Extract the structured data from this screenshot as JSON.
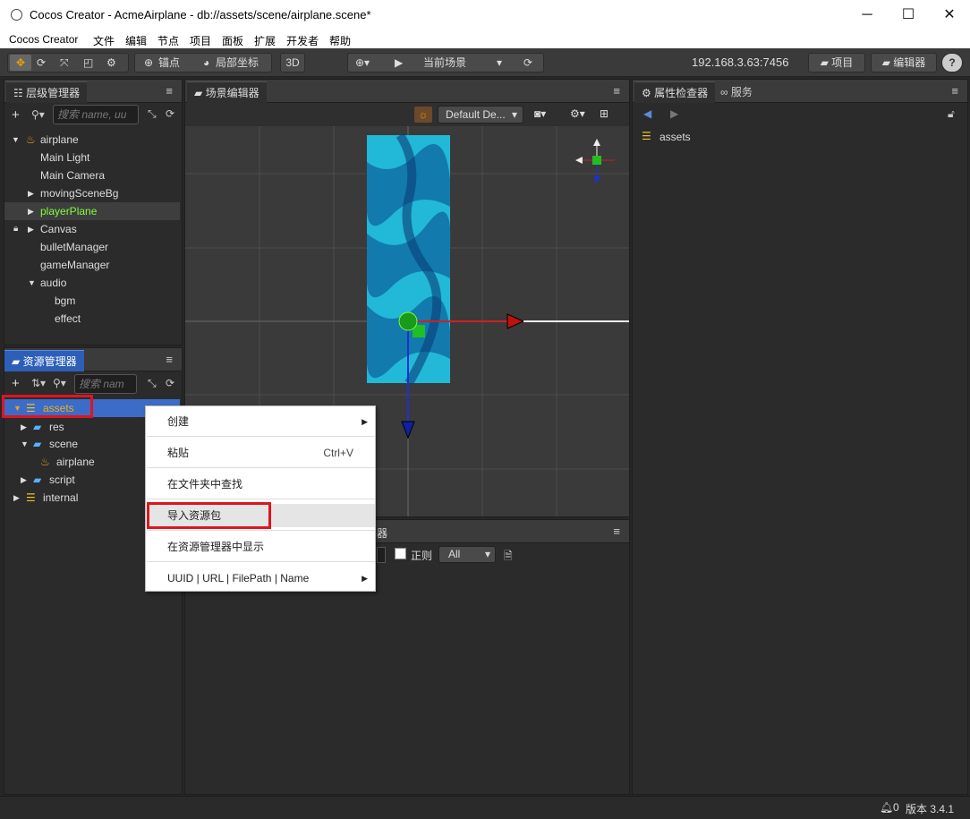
{
  "window": {
    "title": "Cocos Creator - AcmeAirplane - db://assets/scene/airplane.scene*",
    "minimize": "─",
    "maximize": "☐",
    "close": "✕"
  },
  "menubar": {
    "items": [
      "Cocos Creator",
      "文件",
      "编辑",
      "节点",
      "项目",
      "面板",
      "扩展",
      "开发者",
      "帮助"
    ]
  },
  "toolbar": {
    "anchor": "锚点",
    "local_coord": "局部坐标",
    "mode3d": "3D",
    "scene_select": "当前场景",
    "ip": "192.168.3.63:7456",
    "project": "项目",
    "editor": "编辑器",
    "help": "?"
  },
  "hierarchy": {
    "title": "层级管理器",
    "search_placeholder": "搜索 name, uu",
    "root": "airplane",
    "items": [
      "Main Light",
      "Main Camera",
      "movingSceneBg",
      "playerPlane",
      "Canvas",
      "bulletManager",
      "gameManager",
      "audio",
      "bgm",
      "effect"
    ]
  },
  "scene": {
    "title": "场景编辑器",
    "camera_select": "Default De..."
  },
  "assets": {
    "title": "资源管理器",
    "search_placeholder": "搜索 nam",
    "items": [
      "assets",
      "res",
      "scene",
      "airplane",
      "script",
      "internal"
    ]
  },
  "context_menu": {
    "create": "创建",
    "paste": "粘贴",
    "paste_shortcut": "Ctrl+V",
    "find_in_folder": "在文件夹中查找",
    "import_package": "导入资源包",
    "show_in_assets": "在资源管理器中显示",
    "copy_info": "UUID | URL | FilePath | Name"
  },
  "console": {
    "title_partial": "器",
    "regex": "正则",
    "filter": "All"
  },
  "inspector": {
    "title": "属性检查器",
    "service": "服务",
    "selected": "assets"
  },
  "status": {
    "count": "0",
    "version": "版本 3.4.1"
  },
  "colors": {
    "accent": "#e0a020",
    "highlight_green": "#7cff3a",
    "selection": "#3c6cc8",
    "redbox": "#e0141e"
  }
}
